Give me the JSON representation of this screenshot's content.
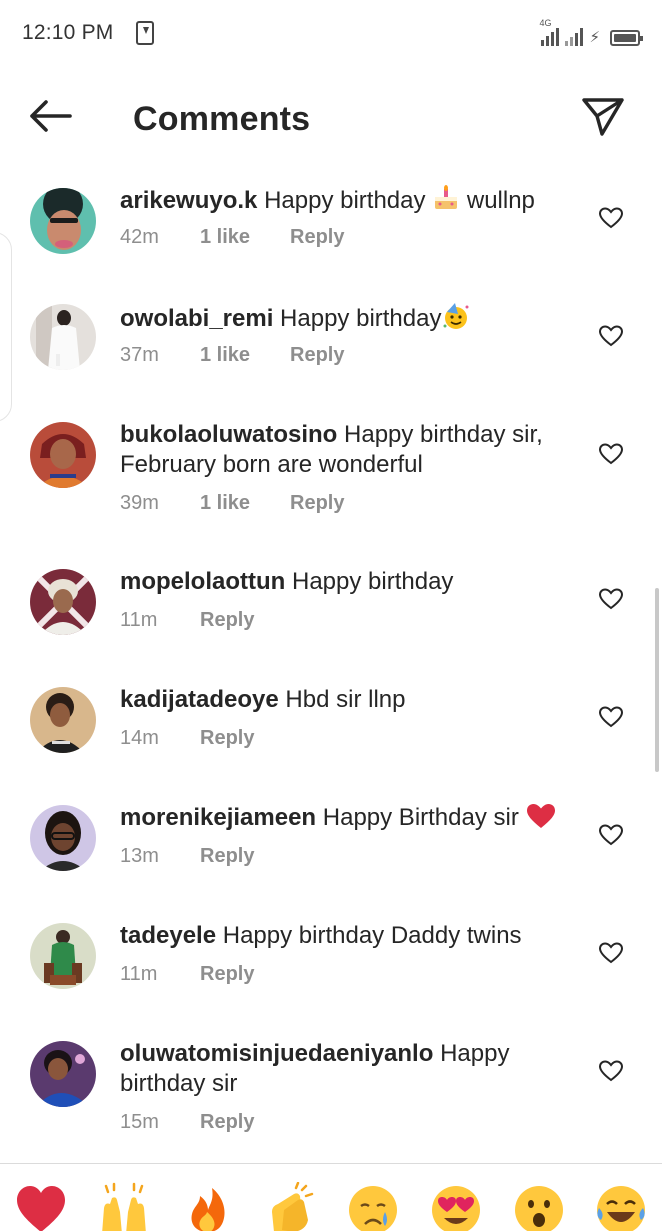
{
  "status_bar": {
    "time": "12:10 PM",
    "network": "4G"
  },
  "header": {
    "title": "Comments",
    "back_icon": "arrow-left-icon",
    "send_icon": "paper-plane-icon"
  },
  "comments": [
    {
      "username": "arikewuyo.k",
      "text": "Happy birthday",
      "text_after": " wullnp",
      "emoji": "birthday-cake",
      "time": "42m",
      "likes": "1 like",
      "reply": "Reply"
    },
    {
      "username": "owolabi_remi",
      "text": "Happy birthday",
      "emoji": "partying-face",
      "time": "37m",
      "likes": "1 like",
      "reply": "Reply"
    },
    {
      "username": "bukolaoluwatosino",
      "text": "Happy birthday sir, February born are wonderful",
      "time": "39m",
      "likes": "1 like",
      "reply": "Reply"
    },
    {
      "username": "mopelolaottun",
      "text": "Happy birthday",
      "time": "11m",
      "reply": "Reply"
    },
    {
      "username": "kadijatadeoye",
      "text": "Hbd sir llnp",
      "time": "14m",
      "reply": "Reply"
    },
    {
      "username": "morenikejiameen",
      "text": "Happy Birthday sir",
      "emoji": "red-heart",
      "time": "13m",
      "reply": "Reply"
    },
    {
      "username": "tadeyele",
      "text": "Happy birthday Daddy twins",
      "time": "11m",
      "reply": "Reply"
    },
    {
      "username": "oluwatomisinjuedaeniyanlo",
      "text": "Happy birthday sir",
      "time": "15m",
      "reply": "Reply"
    }
  ],
  "reaction_bar": [
    "red-heart",
    "raising-hands",
    "fire",
    "clapping-hands",
    "crying-face",
    "heart-eyes",
    "surprised-face",
    "tears-of-joy"
  ],
  "colors": {
    "text": "#262626",
    "meta": "#8e8e8e",
    "divider": "#dbdbdb",
    "heart": "#e0245e"
  }
}
